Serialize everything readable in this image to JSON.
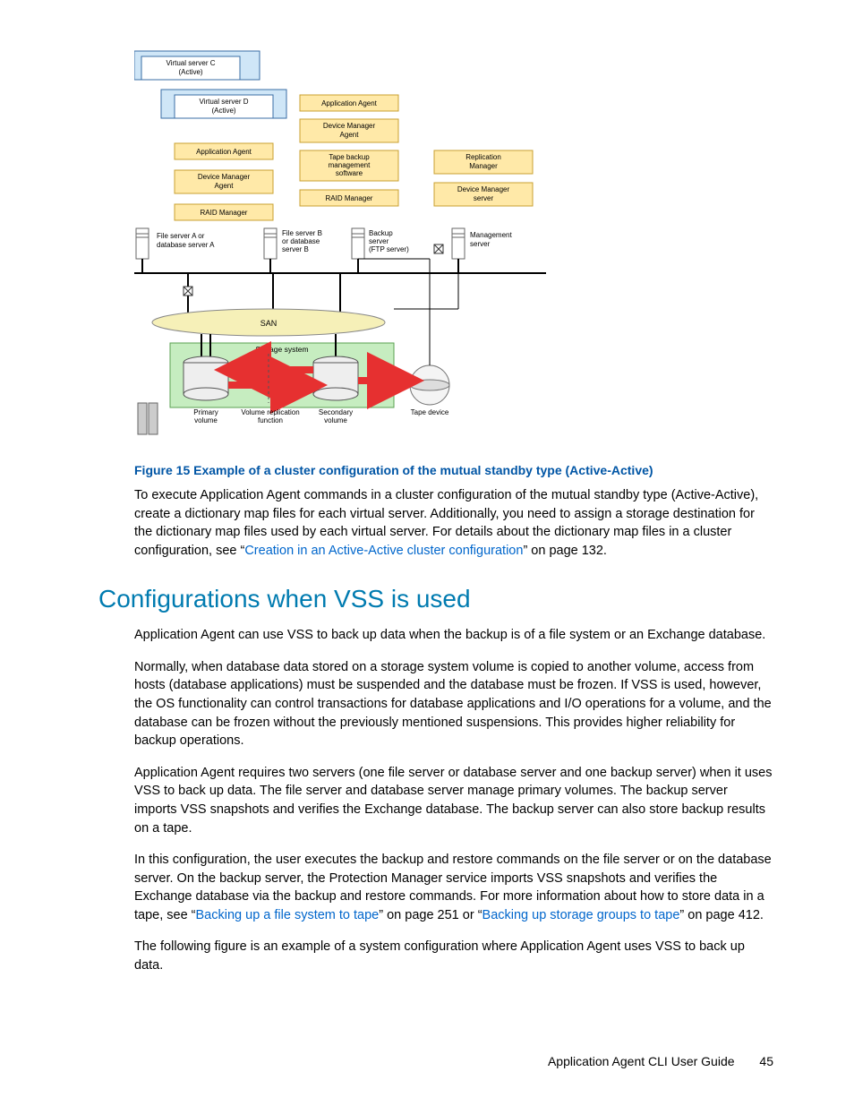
{
  "diagram": {
    "vserverC": "Virtual server C\n(Active)",
    "vserverD": "Virtual server D\n(Active)",
    "appAgent": "Application Agent",
    "devMgrAgent": "Device Manager\nAgent",
    "raidMgr": "RAID Manager",
    "tapeBackup": "Tape backup\nmanagement\nsoftware",
    "replMgr": "Replication\nManager",
    "devMgrServer": "Device Manager\nserver",
    "fileA": "File server A or\ndatabase server A",
    "fileB": "File server B\nor database\nserver B",
    "backupSrv": "Backup\nserver\n(FTP server)",
    "mgmtSrv": "Management\nserver",
    "san": "SAN",
    "storage": "Storage system",
    "primary": "Primary\nvolume",
    "volRepl": "Volume replication\nfunction",
    "secondary": "Secondary\nvolume",
    "tapeDev": "Tape device"
  },
  "figureCaption": "Figure 15 Example of a cluster configuration of the mutual standby type (Active-Active)",
  "para1a": "To execute Application Agent commands in a cluster configuration of the mutual standby type (Active-Active), create a dictionary map files for each virtual server. Additionally, you need to assign a storage destination for the dictionary map files used by each virtual server. For details about the dictionary map files in a cluster configuration, see “",
  "para1link": "Creation in an Active-Active cluster configuration",
  "para1b": "” on page 132.",
  "h2": "Configurations when VSS is used",
  "para2": "Application Agent can use VSS to back up data when the backup is of a file system or an Exchange database.",
  "para3": "Normally, when database data stored on a storage system volume is copied to another volume, access from hosts (database applications) must be suspended and the database must be frozen. If VSS is used, however, the OS functionality can control transactions for database applications and I/O operations for a volume, and the database can be frozen without the previously mentioned suspensions. This provides higher reliability for backup operations.",
  "para4": "Application Agent requires two servers (one file server or database server and one backup server) when it uses VSS to back up data. The file server and database server manage primary volumes. The backup server imports VSS snapshots and verifies the Exchange database. The backup server can also store backup results on a tape.",
  "para5a": "In this configuration, the user executes the backup and restore commands on the file server or on the database server. On the backup server, the Protection Manager service imports VSS snapshots and verifies the Exchange database via the backup and restore commands. For more information about how to store data in a tape, see “",
  "para5link1": "Backing up a file system to tape",
  "para5b": "” on page 251 or “",
  "para5link2": "Backing up storage groups to tape",
  "para5c": "” on page 412.",
  "para6": "The following figure is an example of a system configuration where Application Agent uses VSS to back up data.",
  "footerTitle": "Application Agent CLI User Guide",
  "pageNum": "45"
}
